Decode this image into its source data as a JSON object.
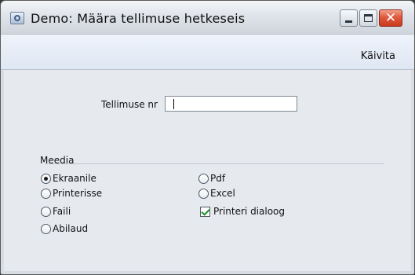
{
  "window": {
    "title": "Demo: Määra tellimuse hetkeseis",
    "close_glyph": "✕"
  },
  "toolbar": {
    "run_label": "Käivita"
  },
  "form": {
    "order_no_label": "Tellimuse nr",
    "order_no_value": ""
  },
  "media": {
    "section_label": "Meedia",
    "options_left": [
      {
        "label": "Ekraanile",
        "selected": true
      },
      {
        "label": "Printerisse",
        "selected": false
      },
      {
        "label": "Faili",
        "selected": false
      },
      {
        "label": "Abilaud",
        "selected": false
      }
    ],
    "options_right": [
      {
        "label": "Pdf",
        "selected": false
      },
      {
        "label": "Excel",
        "selected": false
      }
    ],
    "printer_dialog": {
      "label": "Printeri dialoog",
      "checked": true
    }
  }
}
